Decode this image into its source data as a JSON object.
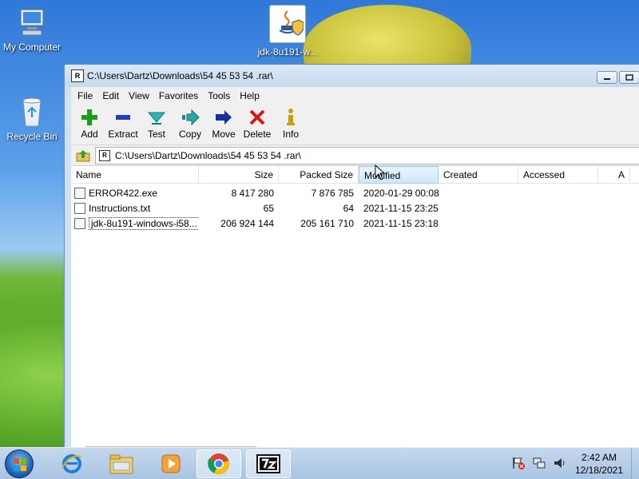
{
  "desktop": {
    "icons": [
      {
        "label": "My Computer"
      },
      {
        "label": "Recycle Bin"
      },
      {
        "label": "jdk-8u191-w..."
      }
    ]
  },
  "window": {
    "title": "C:\\Users\\Dartz\\Downloads\\54 45 53 54 .rar\\",
    "title_icon": "R",
    "menu": [
      "File",
      "Edit",
      "View",
      "Favorites",
      "Tools",
      "Help"
    ],
    "toolbar": [
      {
        "label": "Add",
        "icon": "plus-icon",
        "color": "#1a9e1a"
      },
      {
        "label": "Extract",
        "icon": "minus-icon",
        "color": "#1f3fbf"
      },
      {
        "label": "Test",
        "icon": "check-arrow-icon",
        "color": "#2bb5b5"
      },
      {
        "label": "Copy",
        "icon": "copy-arrow-icon",
        "color": "#1e8a8a"
      },
      {
        "label": "Move",
        "icon": "move-arrow-icon",
        "color": "#1a2f9e"
      },
      {
        "label": "Delete",
        "icon": "delete-x-icon",
        "color": "#d81818"
      },
      {
        "label": "Info",
        "icon": "info-icon",
        "color": "#c8a000"
      }
    ],
    "address": "C:\\Users\\Dartz\\Downloads\\54 45 53 54 .rar\\",
    "address_icon": "R",
    "columns": [
      "Name",
      "Size",
      "Packed Size",
      "Modified",
      "Created",
      "Accessed",
      "A"
    ],
    "files": [
      {
        "name": "ERROR422.exe",
        "size": "8 417 280",
        "packed": "7 876 785",
        "modified": "2020-01-29 00:08"
      },
      {
        "name": "Instructions.txt",
        "size": "65",
        "packed": "64",
        "modified": "2021-11-15 23:25"
      },
      {
        "name": "jdk-8u191-windows-i58...",
        "size": "206 924 144",
        "packed": "205 161 710",
        "modified": "2021-11-15 23:18"
      }
    ]
  },
  "taskbar": {
    "time": "2:42 AM",
    "date": "12/18/2021"
  }
}
